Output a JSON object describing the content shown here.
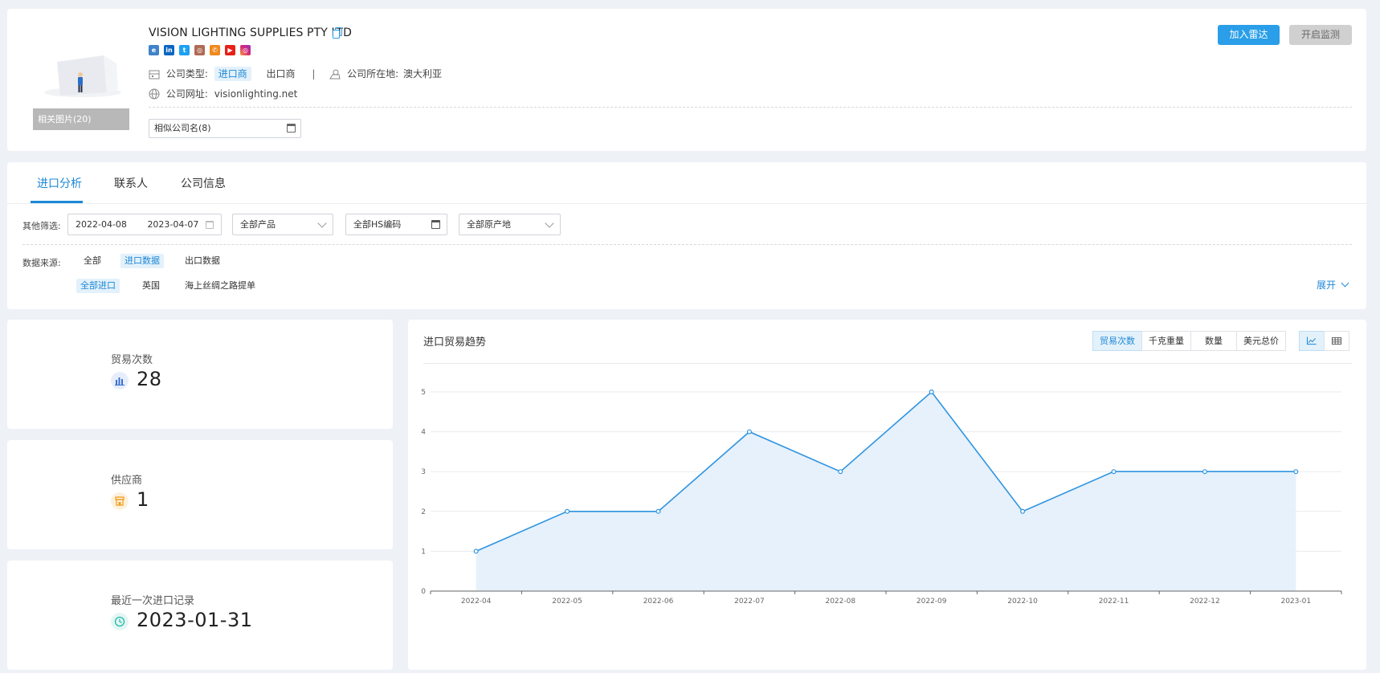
{
  "company": {
    "name": "VISION LIGHTING SUPPLIES PTY LTD",
    "photos_label": "相关图片(20)",
    "type_label": "公司类型:",
    "types": [
      "进口商",
      "出口商"
    ],
    "location_label": "公司所在地:",
    "location": "澳大利亚",
    "website_label": "公司网址:",
    "website": "visionlighting.net",
    "similar_names": "相似公司名(8)",
    "social_icons": [
      "website-icon",
      "linkedin-icon",
      "twitter-icon",
      "instagram-icon",
      "phone-icon",
      "youtube-icon",
      "instagram-color-icon"
    ]
  },
  "actions": {
    "radar": "加入雷达",
    "monitor": "开启监测"
  },
  "tabs": [
    "进口分析",
    "联系人",
    "公司信息"
  ],
  "filters": {
    "label": "其他筛选:",
    "date_start": "2022-04-08",
    "date_end": "2023-04-07",
    "product": "全部产品",
    "hs_code": "全部HS编码",
    "origin": "全部原产地"
  },
  "sources": {
    "label": "数据来源:",
    "main": [
      "全部",
      "进口数据",
      "出口数据"
    ],
    "sub": [
      "全部进口",
      "英国",
      "海上丝绸之路提单"
    ],
    "expand": "展开"
  },
  "stats": [
    {
      "label": "贸易次数",
      "value": "28"
    },
    {
      "label": "供应商",
      "value": "1"
    },
    {
      "label": "最近一次进口记录",
      "value": "2023-01-31"
    }
  ],
  "chart_panel": {
    "title": "进口贸易趋势",
    "metrics": [
      "贸易次数",
      "千克重量",
      "数量",
      "美元总价"
    ]
  },
  "colors": {
    "accent": "#1e88d6",
    "primary_button": "#2a9ee8",
    "line": "#2f94e0",
    "area": "#e3f0fb"
  },
  "chart_data": {
    "type": "area",
    "categories": [
      "2022-04",
      "2022-05",
      "2022-06",
      "2022-07",
      "2022-08",
      "2022-09",
      "2022-10",
      "2022-11",
      "2022-12",
      "2023-01"
    ],
    "values": [
      1,
      2,
      2,
      4,
      3,
      5,
      2,
      3,
      3,
      3
    ],
    "title": "进口贸易趋势",
    "xlabel": "",
    "ylabel": "",
    "ylim": [
      0,
      5
    ],
    "yticks": [
      0,
      1,
      2,
      3,
      4,
      5
    ],
    "grid": true
  }
}
